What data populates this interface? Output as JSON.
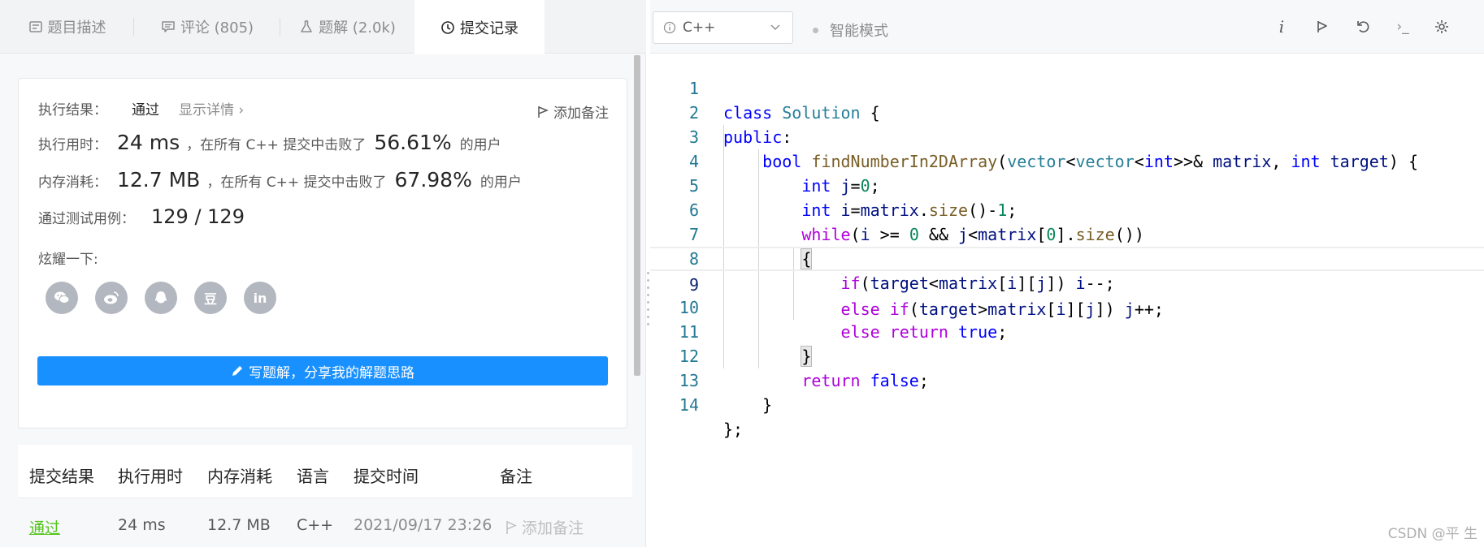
{
  "left_tabs": [
    {
      "label": "题目描述",
      "icon": "description-icon"
    },
    {
      "label": "评论 (805)",
      "icon": "comment-icon"
    },
    {
      "label": "题解 (2.0k)",
      "icon": "flask-icon"
    },
    {
      "label": "提交记录",
      "icon": "clock-icon",
      "active": true
    }
  ],
  "result": {
    "label": "执行结果：",
    "status": "通过",
    "detail": "显示详情 ›",
    "add_note": "添加备注",
    "time_label": "执行用时：",
    "time_value": "24 ms",
    "time_text": "，在所有 C++ 提交中击败了",
    "time_pct": "56.61%",
    "time_suffix": "的用户",
    "mem_label": "内存消耗：",
    "mem_value": "12.7 MB",
    "mem_text": "，在所有 C++ 提交中击败了",
    "mem_pct": "67.98%",
    "mem_suffix": "的用户",
    "cases_label": "通过测试用例：",
    "cases_value": "129 / 129",
    "share_label": "炫耀一下:",
    "share_icons": [
      "wechat-icon",
      "weibo-icon",
      "qq-icon",
      "douban-icon",
      "linkedin-icon"
    ],
    "douban_glyph": "豆",
    "linkedin_glyph": "in",
    "write_button": "写题解，分享我的解题思路"
  },
  "table": {
    "headers": [
      "提交结果",
      "执行用时",
      "内存消耗",
      "语言",
      "提交时间",
      "备注"
    ],
    "row": {
      "result": "通过",
      "time": "24 ms",
      "memory": "12.7 MB",
      "lang": "C++",
      "submitted": "2021/09/17 23:26",
      "note": "添加备注"
    }
  },
  "editor": {
    "language": "C++",
    "mode": "智能模式",
    "icons": [
      "info-icon",
      "run-icon",
      "reset-icon",
      "console-icon",
      "settings-icon"
    ],
    "info_glyph": "i",
    "console_glyph": "›_",
    "line_numbers": [
      "1",
      "2",
      "3",
      "4",
      "5",
      "6",
      "7",
      "8",
      "9",
      "10",
      "11",
      "12",
      "13",
      "14"
    ],
    "lines": [
      "class Solution {",
      "public:",
      "    bool findNumberIn2DArray(vector<vector<int>>& matrix, int target) {",
      "        int j=0;",
      "        int i=matrix.size()-1;",
      "        while(i >= 0 && j<matrix[0].size())",
      "        {",
      "            if(target<matrix[i][j]) i--;",
      "            else if(target>matrix[i][j]) j++;",
      "            else return true;",
      "        }",
      "        return false;",
      "    }",
      "};"
    ]
  },
  "watermark": "CSDN @平 生"
}
